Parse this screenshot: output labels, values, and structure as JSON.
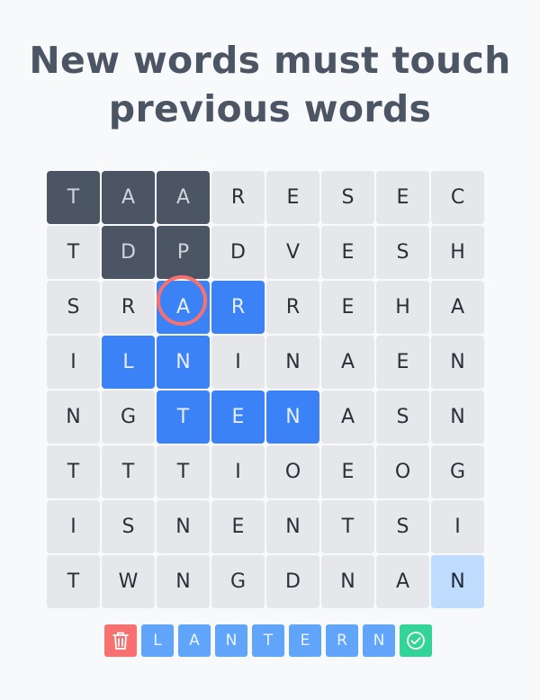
{
  "title": {
    "line1": "New words must touch",
    "line2": "previous words"
  },
  "grid": {
    "rows": [
      [
        "T",
        "A",
        "A",
        "R",
        "E",
        "S",
        "E",
        "C"
      ],
      [
        "T",
        "D",
        "P",
        "D",
        "V",
        "E",
        "S",
        "H"
      ],
      [
        "S",
        "R",
        "A",
        "R",
        "R",
        "E",
        "H",
        "A"
      ],
      [
        "I",
        "L",
        "N",
        "I",
        "N",
        "A",
        "E",
        "N"
      ],
      [
        "N",
        "G",
        "T",
        "E",
        "N",
        "A",
        "S",
        "N"
      ],
      [
        "T",
        "T",
        "T",
        "I",
        "O",
        "E",
        "O",
        "G"
      ],
      [
        "I",
        "S",
        "N",
        "E",
        "N",
        "T",
        "S",
        "I"
      ],
      [
        "T",
        "W",
        "N",
        "G",
        "D",
        "N",
        "A",
        "N"
      ]
    ],
    "used_cells": [
      [
        0,
        0
      ],
      [
        0,
        1
      ],
      [
        0,
        2
      ],
      [
        1,
        1
      ],
      [
        1,
        2
      ]
    ],
    "path_cells": [
      [
        2,
        2
      ],
      [
        2,
        3
      ],
      [
        3,
        1
      ],
      [
        3,
        2
      ],
      [
        4,
        2
      ],
      [
        4,
        3
      ],
      [
        4,
        4
      ]
    ],
    "hint_cells": [
      [
        7,
        7
      ]
    ],
    "highlighted_cell": [
      2,
      2
    ]
  },
  "current_word": {
    "letters": [
      "L",
      "A",
      "N",
      "T",
      "E",
      "R",
      "N"
    ]
  },
  "icons": {
    "delete": "trash-icon",
    "submit": "check-circle-icon"
  },
  "colors": {
    "used": "#4b5563",
    "path": "#3b82f6",
    "hint": "#bfdbfe",
    "ring": "#f87171",
    "tile": "#60a5fa",
    "delete": "#f87171",
    "submit": "#34d399"
  }
}
